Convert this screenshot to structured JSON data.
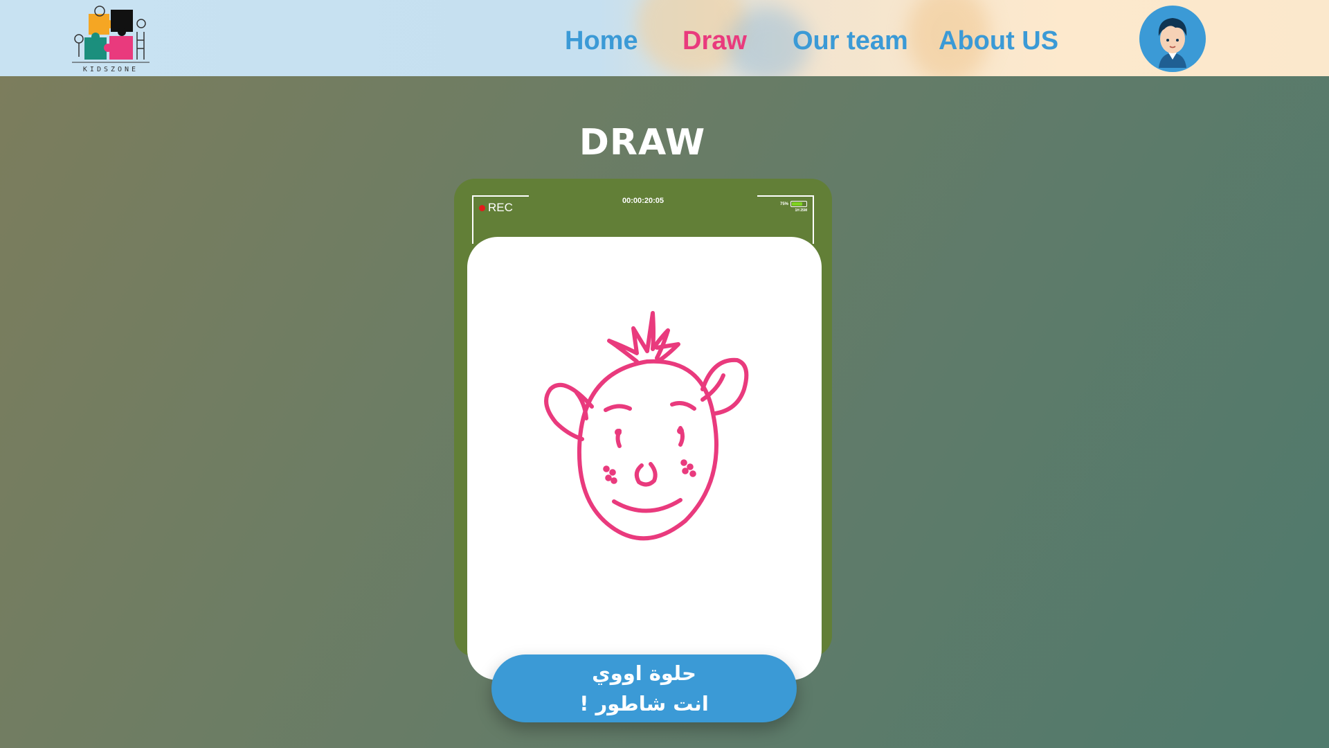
{
  "logo": {
    "text": "KIDSZONE"
  },
  "nav": {
    "home": "Home",
    "draw": "Draw",
    "team": "Our team",
    "about": "About US",
    "active_color": "#e93a7d",
    "link_color": "#3b9ad6"
  },
  "avatar": {
    "icon": "boy-avatar-icon"
  },
  "page": {
    "title": "DRAW"
  },
  "camera": {
    "rec_label": "REC",
    "timecode": "00:00:20:05",
    "battery_percent": "75%",
    "battery_sub": "1H 25M",
    "frame_color": "#627f37"
  },
  "drawing": {
    "icon": "smiling-face-drawing-icon",
    "stroke_color": "#e93a7d"
  },
  "message": {
    "line1": "حلوة اووي",
    "line2": "انت شاطور !"
  }
}
